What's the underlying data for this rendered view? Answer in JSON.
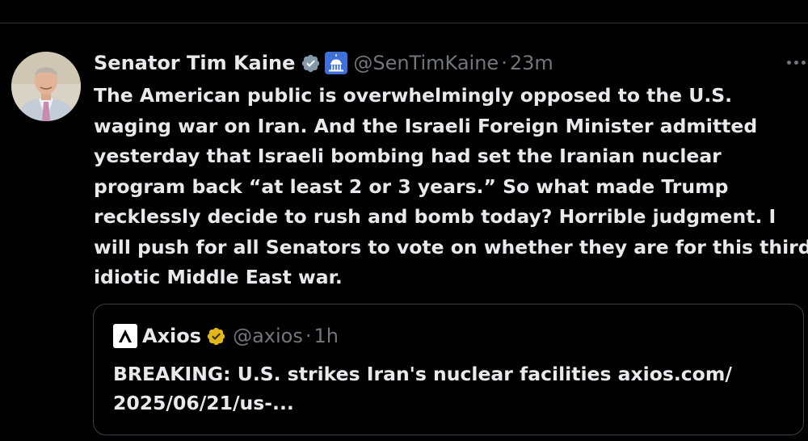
{
  "post": {
    "author": {
      "display_name": "Senator Tim Kaine",
      "handle": "@SenTimKaine",
      "verified_icon": "verified-badge-icon",
      "affiliation_icon": "capitol-icon"
    },
    "separator": "·",
    "time_ago": "23m",
    "more_icon": "more-options-icon",
    "text_lines": [
      "The American public is overwhelmingly opposed to the U.S.",
      "waging war on Iran. And the Israeli Foreign Minister admitted",
      "yesterday that Israeli bombing had set the Iranian nuclear",
      "program back “at least 2 or 3 years.” So what made Trump",
      "recklessly decide to rush and bomb today? Horrible judgment. I",
      "will push for all Senators to vote on whether they are for this third",
      "idiotic Middle East war."
    ]
  },
  "quoted_post": {
    "author": {
      "display_name": "Axios",
      "handle": "@axios",
      "logo_icon": "axios-logo-icon",
      "verified_icon": "gold-verified-badge-icon"
    },
    "separator": "·",
    "time_ago": "1h",
    "text_lines": [
      "BREAKING: U.S. strikes Iran's nuclear facilities axios.com/",
      "2025/06/21/us-..."
    ]
  },
  "colors": {
    "background": "#000000",
    "primary_text": "#e7e9ea",
    "secondary_text": "#71767b",
    "border": "#2f3336",
    "verified_blue": "#1d9bf0",
    "verified_gold": "#e2b719"
  }
}
